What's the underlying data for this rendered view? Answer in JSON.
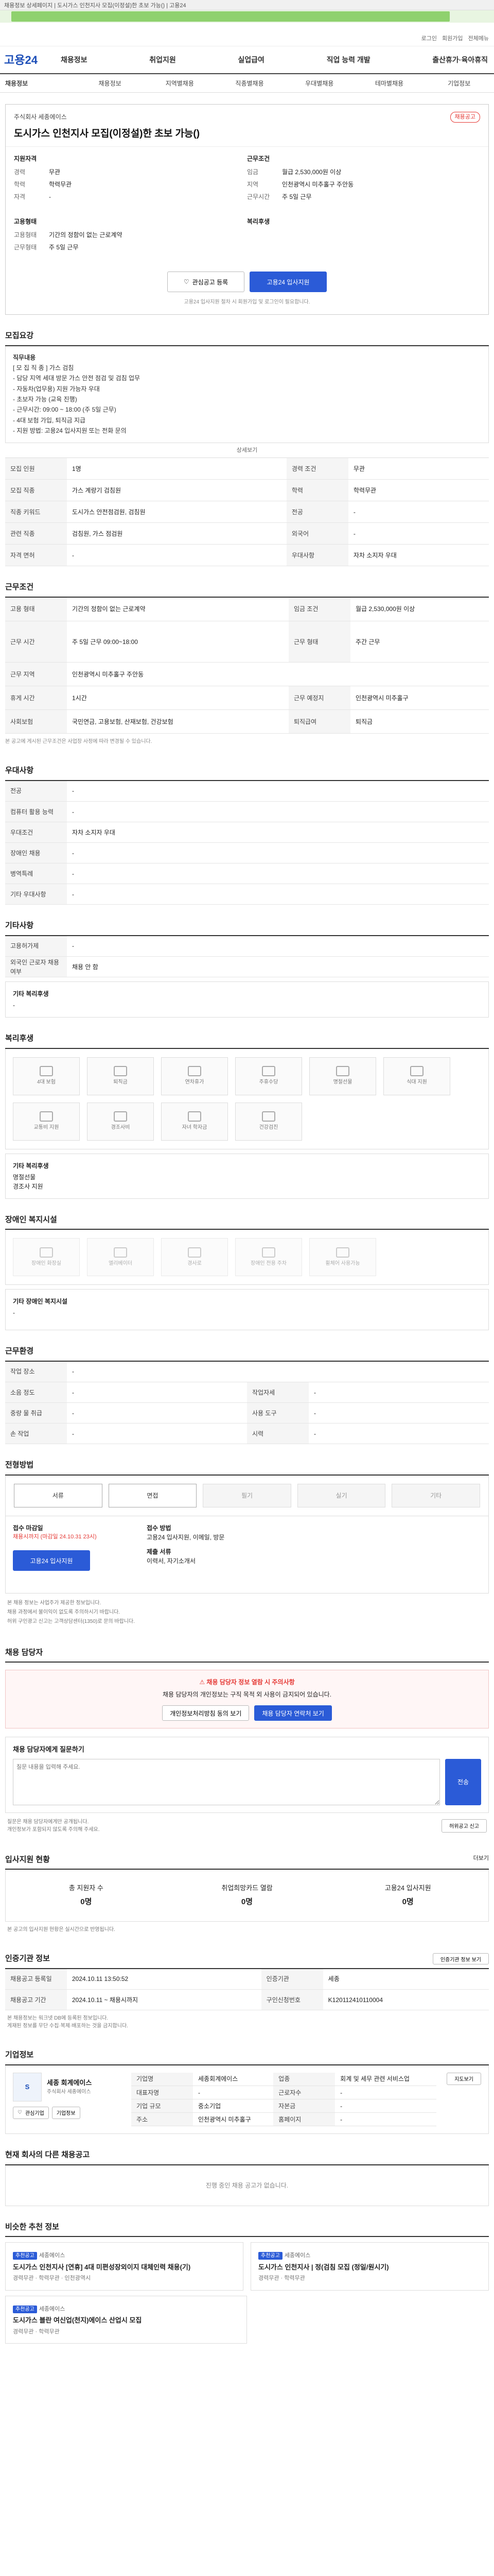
{
  "browser": {
    "tab": "채용정보 상세페이지 | 도시가스 인천지사 모집(이정설)한 초보 가능() | 고용24"
  },
  "header": {
    "logo": "고용24",
    "util": [
      "로그인",
      "회원가입",
      "전체메뉴"
    ],
    "menu": [
      "채용정보",
      "취업지원",
      "실업급여",
      "직업 능력 개발",
      "출산휴가·육아휴직"
    ],
    "sub_menu": [
      "채용정보",
      "채용정보",
      "지역별채용",
      "직종별채용",
      "우대별채용",
      "테마별채용",
      "기업정보"
    ]
  },
  "job": {
    "company": "주식회사 세종에이스",
    "badge": "채용공고",
    "title": "도시가스 인천지사 모집(이정설)한 초보 가능()",
    "summary_left_title": "지원자격",
    "summary_right_title": "근무조건",
    "left": [
      [
        "경력",
        "무관"
      ],
      [
        "학력",
        "학력무관"
      ],
      [
        "자격",
        "-"
      ]
    ],
    "right": [
      [
        "임금",
        "월급 2,530,000원 이상"
      ],
      [
        "지역",
        "인천광역시 미추홀구 주안동"
      ],
      [
        "근무시간",
        "주 5일 근무"
      ]
    ],
    "left2_title": "고용형태",
    "left2": [
      [
        "고용형태",
        "기간의 정함이 없는 근로계약"
      ],
      [
        "근무형태",
        "주 5일 근무"
      ]
    ],
    "right2_title": "복리후생",
    "btn_scrap": "관심공고 등록",
    "btn_apply": "고용24 입사지원",
    "note": "고용24 입사지원 절차 시 회원가입 및 로그인이 필요합니다."
  },
  "duty": {
    "title": "모집요강",
    "body": [
      "직무내용",
      "[ 모 집 직 종 ] 가스 검침",
      "- 담당 지역 세대 방문 가스 안전 점검 및 검침 업무",
      "- 자동차(업무용) 지원 가능자 우대",
      "- 초보자 가능 (교육 진행)",
      "- 근무시간: 09:00 ~ 18:00 (주 5일 근무)",
      "- 4대 보험 가입, 퇴직금 지급",
      "- 지원 방법: 고용24 입사지원 또는 전화 문의"
    ],
    "more": "상세보기"
  },
  "recruit": [
    [
      "모집 인원",
      "1명",
      "경력 조건",
      "무관"
    ],
    [
      "모집 직종",
      "가스 계량기 검침원",
      "학력",
      "학력무관"
    ],
    [
      "직종 키워드",
      "도시가스 안전점검원, 검침원",
      "전공",
      "-"
    ],
    [
      "관련 직종",
      "검침원, 가스 점검원",
      "외국어",
      "-"
    ],
    [
      "자격 면허",
      "-",
      "우대사항",
      "자차 소지자 우대"
    ]
  ],
  "condition_title": "근무조건",
  "condition": [
    [
      "고용 형태",
      "기간의 정함이 없는 근로계약",
      "임금 조건",
      "월급 2,530,000원 이상"
    ],
    [
      "근무 시간",
      "주 5일 근무 09:00~18:00",
      "근무 형태",
      "주간 근무"
    ],
    [
      "근무 지역",
      "인천광역시 미추홀구 주안동",
      "",
      ""
    ],
    [
      "휴게 시간",
      "1시간",
      "근무 예정지",
      "인천광역시 미추홀구"
    ],
    [
      "사회보험",
      "국민연금, 고용보험, 산재보험, 건강보험",
      "퇴직급여",
      "퇴직금"
    ]
  ],
  "condition_note": "본 공고에 게시된 근무조건은 사업장 사정에 따라 변경될 수 있습니다.",
  "pref": {
    "title": "우대사항",
    "rows": [
      [
        "전공",
        "-"
      ],
      [
        "컴퓨터 활용 능력",
        "-"
      ],
      [
        "우대조건",
        "자차 소지자 우대"
      ],
      [
        "장애인 채용",
        "-"
      ],
      [
        "병역특례",
        "-"
      ],
      [
        "기타 우대사항",
        "-"
      ]
    ]
  },
  "etc": {
    "title": "기타사항",
    "rows": [
      [
        "고용허가제",
        "-"
      ],
      [
        "외국인 근로자 채용 여부",
        "채용 안 함"
      ]
    ],
    "box_title": "기타 복리후생",
    "box_text": "-"
  },
  "welfare": {
    "title": "복리후생",
    "icons": [
      "4대 보험",
      "퇴직금",
      "연차휴가",
      "주휴수당",
      "명절선물",
      "식대 지원",
      "교통비 지원",
      "경조사비",
      "자녀 학자금",
      "건강검진"
    ],
    "box_title": "기타 복리후생",
    "box_items": [
      "명절선물",
      "경조사 지원"
    ]
  },
  "disab": {
    "title": "장애인 복지시설",
    "icons": [
      "장애인 화장실",
      "엘리베이터",
      "경사로",
      "장애인 전용 주차",
      "휠체어 사용가능"
    ],
    "box_title": "기타 장애인 복지시설",
    "box_text": "-"
  },
  "place": {
    "title": "근무환경",
    "rows": [
      [
        "작업 장소",
        "-",
        "",
        ""
      ],
      [
        "소음 정도",
        "-",
        "작업자세",
        "-"
      ],
      [
        "중량 물 취급",
        "-",
        "사용 도구",
        "-"
      ],
      [
        "손 작업",
        "-",
        "시력",
        "-"
      ]
    ]
  },
  "process": {
    "title": "전형방법",
    "steps": [
      "서류",
      "면접",
      "필기",
      "실기",
      "기타"
    ],
    "apply_title": "접수 마감일",
    "apply_date": "채용시까지 (마감일 24.10.31 23시)",
    "method_title": "접수 방법",
    "method": "고용24 입사지원, 이메일, 방문",
    "docs_title": "제출 서류",
    "docs": "이력서, 자기소개서",
    "apply_btn": "고용24 입사지원",
    "notes": [
      "본 채용 정보는 사업주가 제공한 정보입니다.",
      "채용 과정에서 불이익이 없도록 주의하시기 바랍니다.",
      "허위 구인광고 신고는 고객상담센터(1350)로 문의 바랍니다."
    ]
  },
  "contact": {
    "title": "채용 담당자",
    "alert_title": "채용 담당자 정보 열람 시 주의사항",
    "alert_text": "채용 담당자의 개인정보는 구직 목적 외 사용이 금지되어 있습니다.",
    "btn1": "개인정보처리방침 동의 보기",
    "btn2": "채용 담당자 연락처 보기",
    "qa_title": "채용 담당자에게 질문하기",
    "qa_hint": "질문 내용을 입력해 주세요.",
    "qa_btn": "전송",
    "notes": [
      "질문은 채용 담당자에게만 공개됩니다.",
      "개인정보가 포함되지 않도록 주의해 주세요."
    ],
    "report_btn": "허위공고 신고"
  },
  "apply_stat": {
    "title": "입사지원 현황",
    "more": "더보기",
    "items": [
      [
        "총 지원자 수",
        "0명"
      ],
      [
        "취업희망카드 열람",
        "0명"
      ],
      [
        "고용24 입사지원",
        "0명"
      ]
    ],
    "note": "본 공고의 입사지원 현황은 실시간으로 반영됩니다."
  },
  "info": {
    "title": "인증기관 정보",
    "btn": "인증기관 정보 보기",
    "rows": [
      [
        "채용공고 등록일",
        "2024.10.11 13:50:52",
        "인증기관",
        "세종"
      ],
      [
        "채용공고 기간",
        "2024.10.11 ~ 채용시까지",
        "구인신청번호",
        "K120112410110004"
      ]
    ],
    "notes": [
      "본 채용정보는 워크넷 DB에 등록된 정보입니다.",
      "게재된 정보를 무단 수집·복제·배포하는 것을 금지합니다."
    ]
  },
  "company": {
    "title": "기업정보",
    "name": "세종 회계에이스",
    "sub": "주식회사 세종에이스",
    "btn1": "관심기업",
    "btn2": "기업정보",
    "rows": [
      [
        "기업명",
        "세종회계에이스",
        "업종",
        "회계 및 세무 관련 서비스업"
      ],
      [
        "대표자명",
        "-",
        "근로자수",
        "-"
      ],
      [
        "기업 규모",
        "중소기업",
        "자본금",
        "-"
      ],
      [
        "주소",
        "인천광역시 미추홀구",
        "홈페이지",
        "-"
      ]
    ],
    "map_btn": "지도보기"
  },
  "related": {
    "title": "현재 회사의 다른 채용공고",
    "empty": "진행 중인 채용 공고가 없습니다."
  },
  "similar": {
    "title": "비슷한 추천 정보",
    "items": [
      {
        "tag": "추천공고",
        "company": "세종에이스",
        "title": "도시가스 인천지사 [연휴] 4대 미편성장외이지 대체인력 채용(기)",
        "meta": "경력무관 · 학력무관 · 인천광역시"
      },
      {
        "tag": "추천공고",
        "company": "세종에이스",
        "title": "도시가스 인천지사 | 정(검침 모집 (정일/원시기)",
        "meta": "경력무관 · 학력무관"
      },
      {
        "tag": "추천공고",
        "company": "세종에이스",
        "title": "도시가스 블란 여신업(천지)에이스 산업시 모집",
        "meta": "경력무관 · 학력무관"
      }
    ]
  }
}
